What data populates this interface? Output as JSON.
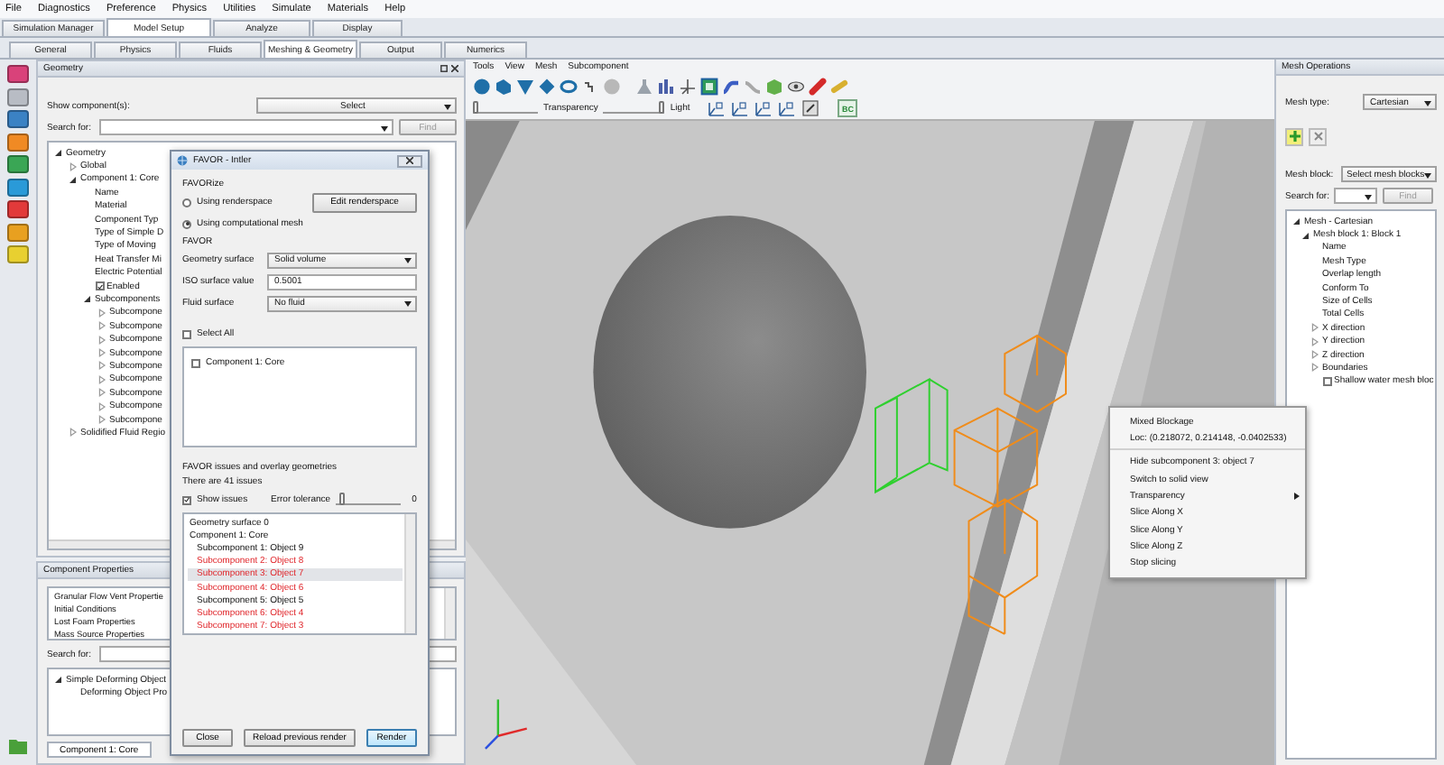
{
  "menu": [
    "File",
    "Diagnostics",
    "Preference",
    "Physics",
    "Utilities",
    "Simulate",
    "Materials",
    "Help"
  ],
  "main_tabs": [
    {
      "label": "Simulation Manager",
      "selected": false
    },
    {
      "label": "Model Setup",
      "selected": true
    },
    {
      "label": "Analyze",
      "selected": false
    },
    {
      "label": "Display",
      "selected": false
    }
  ],
  "sub_tabs": [
    {
      "label": "General",
      "selected": false
    },
    {
      "label": "Physics",
      "selected": false
    },
    {
      "label": "Fluids",
      "selected": false
    },
    {
      "label": "Meshing & Geometry",
      "selected": true
    },
    {
      "label": "Output",
      "selected": false
    },
    {
      "label": "Numerics",
      "selected": false
    }
  ],
  "geometry_panel": {
    "title": "Geometry",
    "show_label": "Show component(s):",
    "show_value": "Select",
    "search_label": "Search for:",
    "find": "Find",
    "tree": [
      {
        "label": "Geometry",
        "expanded": true,
        "children": [
          {
            "label": "Global",
            "expanded": false
          },
          {
            "label": "Component 1: Core",
            "expanded": true,
            "children": [
              {
                "label": "Name"
              },
              {
                "label": "Material"
              },
              {
                "label": "Component Typ"
              },
              {
                "label": "Type of Simple D"
              },
              {
                "label": "Type of Moving"
              },
              {
                "label": "Heat Transfer Mi"
              },
              {
                "label": "Electric Potential"
              },
              {
                "label": "Enabled",
                "checked": true
              },
              {
                "label": "Subcomponents",
                "expanded": true,
                "children": [
                  {
                    "label": "Subcompone",
                    "expanded": false
                  },
                  {
                    "label": "Subcompone",
                    "expanded": false
                  },
                  {
                    "label": "Subcompone",
                    "expanded": false
                  },
                  {
                    "label": "Subcompone",
                    "expanded": false
                  },
                  {
                    "label": "Subcompone",
                    "expanded": false
                  },
                  {
                    "label": "Subcompone",
                    "expanded": false
                  },
                  {
                    "label": "Subcompone",
                    "expanded": false
                  },
                  {
                    "label": "Subcompone",
                    "expanded": false
                  },
                  {
                    "label": "Subcompone",
                    "expanded": false
                  }
                ]
              }
            ]
          },
          {
            "label": "Solidified Fluid Regio",
            "expanded": false
          }
        ]
      }
    ]
  },
  "component_properties": {
    "title": "Component Properties",
    "items": [
      "Granular Flow Vent Propertie",
      "Initial Conditions",
      "Lost Foam Properties",
      "Mass Source Properties"
    ],
    "search_label": "Search for:",
    "tree": [
      {
        "label": "Simple Deforming Object",
        "expanded": true,
        "children": [
          {
            "label": "Deforming Object Pro"
          }
        ]
      }
    ],
    "tab": "Component 1: Core"
  },
  "viewport": {
    "menu": [
      "Tools",
      "View",
      "Mesh",
      "Subcomponent"
    ],
    "transparency": {
      "label": "Transparency",
      "level": 0
    },
    "light": {
      "label": "Light",
      "level": 1
    },
    "bc_button": "BC"
  },
  "mesh_operations": {
    "title": "Mesh Operations",
    "mesh_type_label": "Mesh type:",
    "mesh_type": "Cartesian",
    "mesh_block_label": "Mesh block:",
    "mesh_block": "Select mesh blocks",
    "search_label": "Search for:",
    "find": "Find",
    "tree": [
      {
        "label": "Mesh - Cartesian",
        "expanded": true,
        "children": [
          {
            "label": "Mesh block 1: Block 1",
            "expanded": true,
            "children": [
              {
                "label": "Name"
              },
              {
                "label": "Mesh Type"
              },
              {
                "label": "Overlap length"
              },
              {
                "label": "Conform To"
              },
              {
                "label": "Size of Cells"
              },
              {
                "label": "Total Cells"
              },
              {
                "label": "X direction",
                "expanded": false
              },
              {
                "label": "Y direction",
                "expanded": false
              },
              {
                "label": "Z direction",
                "expanded": false
              },
              {
                "label": "Boundaries",
                "expanded": false
              },
              {
                "label": "Shallow water mesh bloc",
                "checked": false
              }
            ]
          }
        ]
      }
    ]
  },
  "favor_dialog": {
    "title": "FAVOR - Intler",
    "favorize_label": "FAVORize",
    "favorize_options": [
      {
        "label": "Using renderspace",
        "selected": false
      },
      {
        "label": "Using computational mesh",
        "selected": true
      }
    ],
    "edit_button": "Edit renderspace",
    "favor_label": "FAVOR",
    "geometry_surface": {
      "label": "Geometry surface",
      "value": "Solid volume"
    },
    "iso_surface": {
      "label": "ISO surface value",
      "value": "0.5001"
    },
    "fluid_surface": {
      "label": "Fluid surface",
      "value": "No fluid"
    },
    "select_all": {
      "label": "Select All",
      "checked": false
    },
    "components": [
      {
        "label": "Component 1: Core",
        "checked": false
      }
    ],
    "issues_label": "FAVOR issues and overlay geometries",
    "issues_count": "There are 41 issues",
    "show_issues": {
      "label": "Show issues",
      "checked": true
    },
    "error_tolerance": {
      "label": "Error tolerance",
      "level": 0.05,
      "reading": "0"
    },
    "issues": [
      {
        "label": "Geometry surface 0",
        "error": false,
        "selected": false
      },
      {
        "label": "Component 1: Core",
        "error": false,
        "selected": false,
        "children": [
          {
            "label": "Subcomponent 1: Object 9",
            "error": false,
            "selected": false
          },
          {
            "label": "Subcomponent 2: Object 8",
            "error": true,
            "selected": false
          },
          {
            "label": "Subcomponent 3: Object 7",
            "error": true,
            "selected": true
          },
          {
            "label": "Subcomponent 4: Object 6",
            "error": true,
            "selected": false
          },
          {
            "label": "Subcomponent 5: Object 5",
            "error": false,
            "selected": false
          },
          {
            "label": "Subcomponent 6: Object 4",
            "error": true,
            "selected": false
          },
          {
            "label": "Subcomponent 7: Object 3",
            "error": true,
            "selected": false
          }
        ]
      }
    ],
    "buttons": [
      {
        "label": "Close",
        "default": false
      },
      {
        "label": "Reload previous render",
        "default": false
      },
      {
        "label": "Render",
        "default": true
      }
    ]
  },
  "context_menu": {
    "items": [
      {
        "label": "Mixed Blockage",
        "separator_before": false,
        "submenu": false
      },
      {
        "label": "Loc: (0.218072, 0.214148, -0.0402533)",
        "separator_before": false,
        "submenu": false
      },
      {
        "label": "Hide subcomponent 3: object 7",
        "separator_before": true,
        "submenu": false
      },
      {
        "label": "Switch to solid view",
        "separator_before": false,
        "submenu": false
      },
      {
        "label": "Transparency",
        "separator_before": false,
        "submenu": true
      },
      {
        "label": "Slice Along X",
        "separator_before": false,
        "submenu": false
      },
      {
        "label": "Slice Along Y",
        "separator_before": false,
        "submenu": false
      },
      {
        "label": "Slice Along Z",
        "separator_before": false,
        "submenu": false
      },
      {
        "label": "Stop slicing",
        "separator_before": false,
        "submenu": false
      }
    ]
  }
}
